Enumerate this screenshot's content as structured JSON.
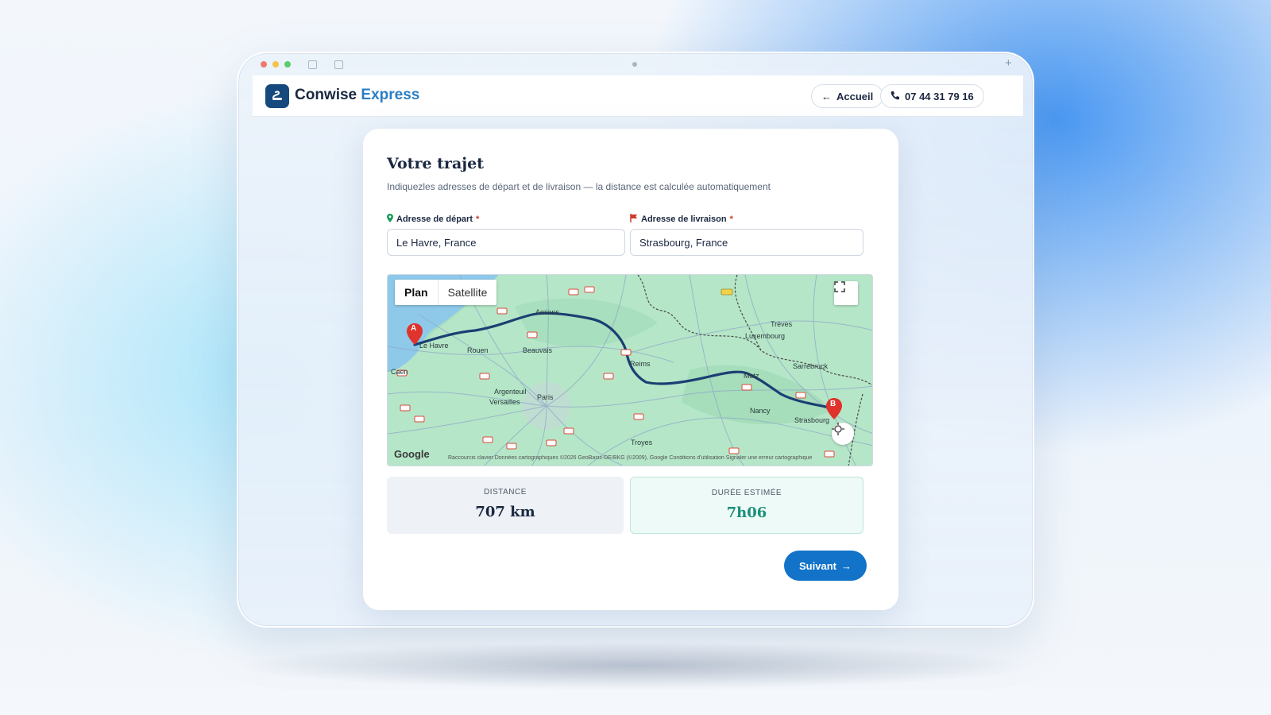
{
  "header": {
    "brand_main": "Conwise",
    "brand_accent": "Express",
    "home_label": "Accueil",
    "phone": "07 44 31 79 16"
  },
  "trip": {
    "title": "Votre trajet",
    "subtitle": "Indiquezles adresses de départ et de livraison — la distance est calculée automatiquement",
    "departure_label": "Adresse de départ",
    "departure_value": "Le Havre, France",
    "delivery_label": "Adresse de livraison",
    "delivery_value": "Strasbourg, France",
    "required_mark": "*"
  },
  "map": {
    "plan_label": "Plan",
    "satellite_label": "Satellite",
    "marker_a": "A",
    "marker_b": "B",
    "google": "Google",
    "attribution": "Raccourcis clavier  Données cartographiques ©2026 GeoBasis-DE/BKG (©2009), Google  Conditions d'utilisation  Signaler une erreur cartographique",
    "places": {
      "le_havre": "Le Havre",
      "caen": "Caen",
      "rouen": "Rouen",
      "amiens": "Amiens",
      "beauvais": "Beauvais",
      "argenteuil": "Argenteuil",
      "versailles": "Versailles",
      "paris": "Paris",
      "reims": "Reims",
      "metz": "Metz",
      "luxembourg": "Luxembourg",
      "treves": "Trèves",
      "sarrebruck": "Sarrebruck",
      "nancy": "Nancy",
      "strasbourg": "Strasbourg",
      "troyes": "Troyes"
    },
    "colors": {
      "route": "#1c3f73",
      "marker": "#e0332b",
      "water": "#8ec9ea",
      "land": "#a7dfbf"
    }
  },
  "stats": {
    "distance_label": "DISTANCE",
    "distance_value": "707 km",
    "duration_label": "DURÉE ESTIMÉE",
    "duration_value": "7h06"
  },
  "actions": {
    "next_label": "Suivant"
  },
  "icons": {
    "logo": "truck-logo-icon",
    "back": "arrow-left-icon",
    "phone": "phone-icon",
    "pin": "map-pin-icon",
    "flag": "flag-icon",
    "fullscreen": "fullscreen-icon",
    "locate": "locate-icon",
    "next": "arrow-right-icon"
  },
  "theme": {
    "primary": "#1273c9",
    "accent": "#2b7fc4",
    "teal": "#1a8f7a"
  }
}
